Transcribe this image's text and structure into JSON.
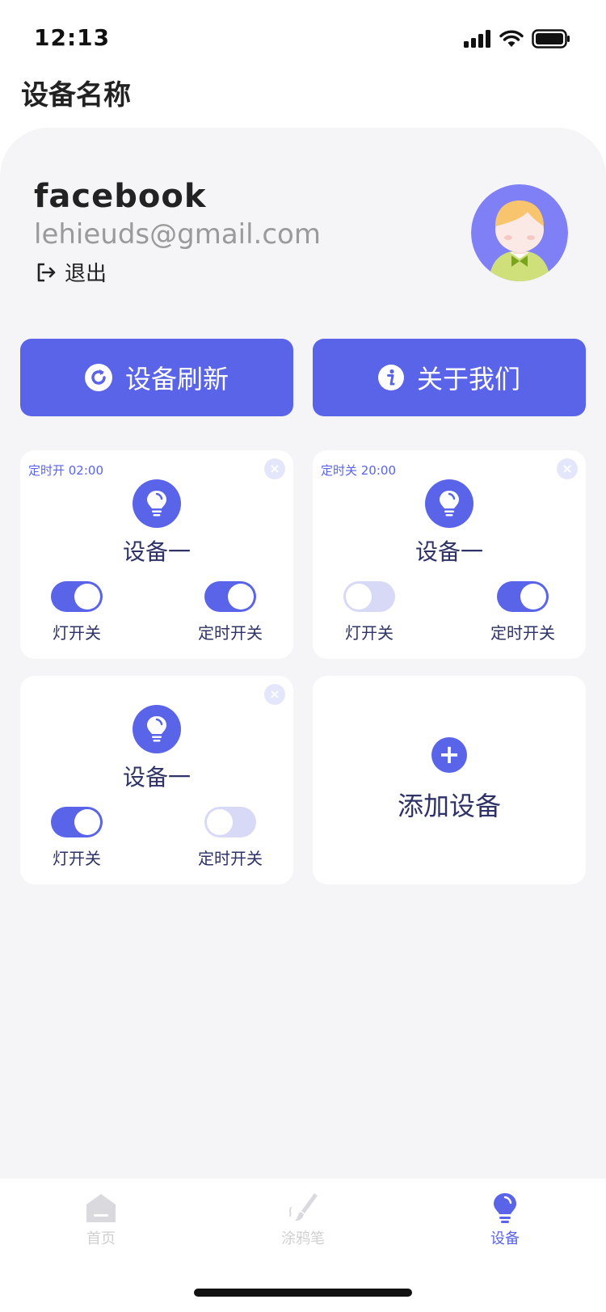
{
  "status": {
    "time": "12:13"
  },
  "page_title": "设备名称",
  "profile": {
    "username": "facebook",
    "email": "lehieuds@gmail.com",
    "logout_label": "退出"
  },
  "actions": {
    "refresh_label": "设备刷新",
    "about_label": "关于我们"
  },
  "devices": [
    {
      "timer": "定时开 02:00",
      "name": "设备一",
      "light_label": "灯开关",
      "timer_switch_label": "定时开关",
      "light_on": true,
      "timer_on": true
    },
    {
      "timer": "定时关 20:00",
      "name": "设备一",
      "light_label": "灯开关",
      "timer_switch_label": "定时开关",
      "light_on": false,
      "timer_on": true
    },
    {
      "timer": "",
      "name": "设备一",
      "light_label": "灯开关",
      "timer_switch_label": "定时开关",
      "light_on": true,
      "timer_on": false
    }
  ],
  "add_device_label": "添加设备",
  "tabs": [
    {
      "label": "首页",
      "icon": "home-icon",
      "active": false
    },
    {
      "label": "涂鸦笔",
      "icon": "paintbrush-icon",
      "active": false
    },
    {
      "label": "设备",
      "icon": "bulb-icon",
      "active": true
    }
  ],
  "colors": {
    "accent": "#5a64e8",
    "panel_bg": "#f5f5f7",
    "toggle_off": "#d7d9f7",
    "text_dark": "#2f3266"
  }
}
